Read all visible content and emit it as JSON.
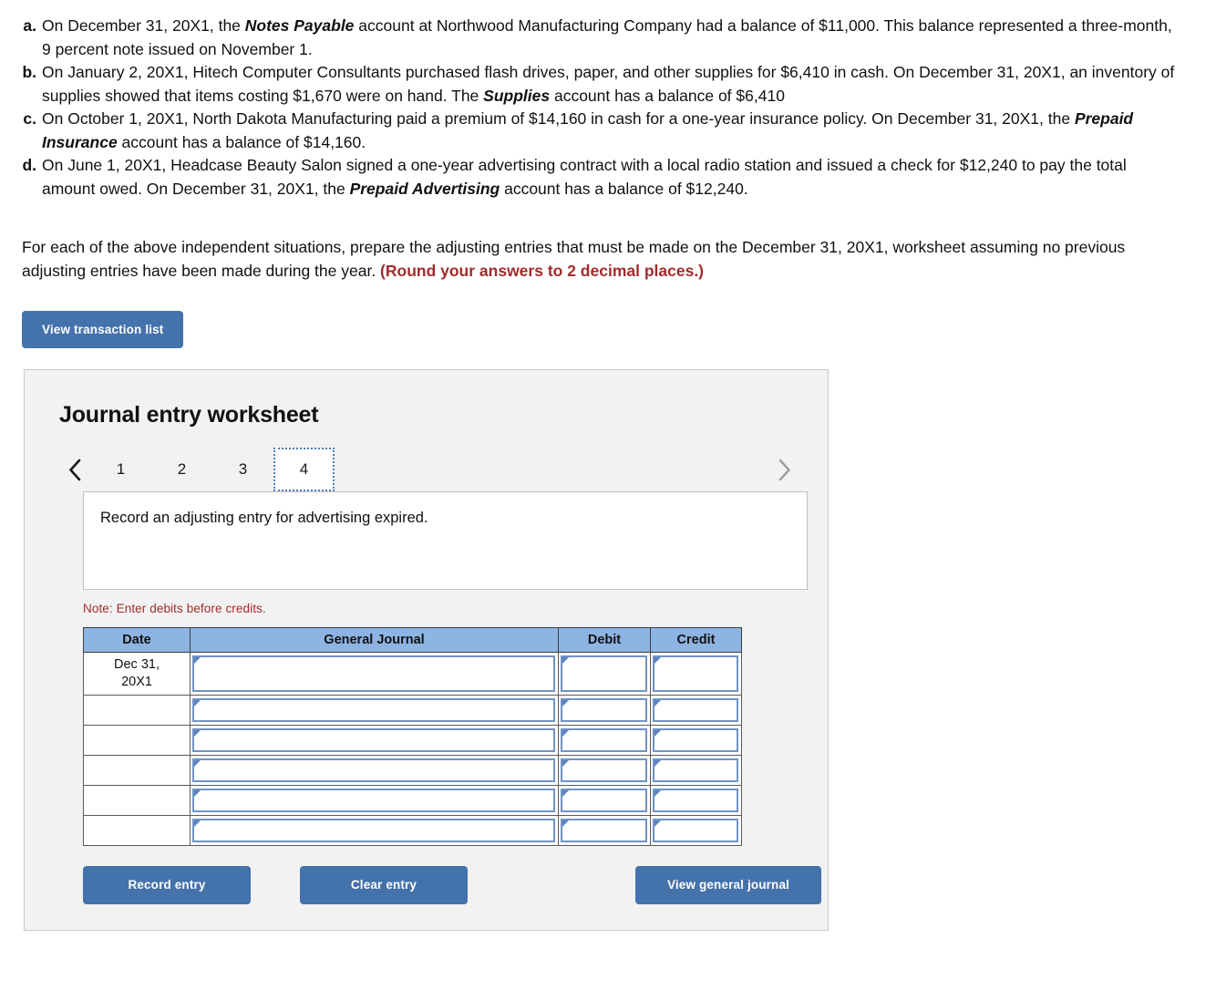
{
  "problems": [
    {
      "letter": "a.",
      "parts": [
        {
          "t": "On December 31, 20X1, the ",
          "b": false
        },
        {
          "t": "Notes Payable",
          "b": true
        },
        {
          "t": " account at Northwood Manufacturing Company had a balance of $11,000. This balance represented a three-month, 9 percent note issued on November 1.",
          "b": false
        }
      ]
    },
    {
      "letter": "b.",
      "parts": [
        {
          "t": "On January 2, 20X1, Hitech Computer Consultants purchased flash drives, paper, and other supplies for $6,410 in cash. On December 31, 20X1, an inventory of supplies showed that items costing $1,670 were on hand. The ",
          "b": false
        },
        {
          "t": "Supplies",
          "b": true
        },
        {
          "t": " account has a balance of $6,410",
          "b": false
        }
      ]
    },
    {
      "letter": "c.",
      "parts": [
        {
          "t": "On October 1, 20X1, North Dakota Manufacturing paid a premium of $14,160 in cash for a one-year insurance policy. On December 31, 20X1, the ",
          "b": false
        },
        {
          "t": "Prepaid Insurance",
          "b": true
        },
        {
          "t": " account has a balance of $14,160.",
          "b": false
        }
      ]
    },
    {
      "letter": "d.",
      "parts": [
        {
          "t": "On June 1, 20X1, Headcase Beauty Salon signed a one-year advertising contract with a local radio station and issued a check for $12,240 to pay the total amount owed. On December 31, 20X1, the ",
          "b": false
        },
        {
          "t": "Prepaid Advertising",
          "b": true
        },
        {
          "t": " account has a balance of $12,240.",
          "b": false
        }
      ]
    }
  ],
  "instruction": {
    "main": "For each of the above independent situations, prepare the adjusting entries that must be made on the December 31, 20X1, worksheet assuming no previous adjusting entries have been made during the year. ",
    "emphasis": "(Round your answers to 2 decimal places.)"
  },
  "transaction_button": {
    "label": "View transaction list"
  },
  "worksheet": {
    "title": "Journal entry worksheet",
    "prev_arrow_icon": "chevron-left-icon",
    "next_arrow_icon": "chevron-right-icon",
    "tabs": [
      {
        "label": "1",
        "active": false
      },
      {
        "label": "2",
        "active": false
      },
      {
        "label": "3",
        "active": false
      },
      {
        "label": "4",
        "active": true
      }
    ],
    "description": "Record an adjusting entry for advertising expired.",
    "note": "Note: Enter debits before credits.",
    "table": {
      "headers": [
        "Date",
        "General Journal",
        "Debit",
        "Credit"
      ],
      "rows": [
        {
          "date": "Dec 31,\n20X1",
          "general_journal": "",
          "debit": "",
          "credit": ""
        },
        {
          "date": "",
          "general_journal": "",
          "debit": "",
          "credit": ""
        },
        {
          "date": "",
          "general_journal": "",
          "debit": "",
          "credit": ""
        },
        {
          "date": "",
          "general_journal": "",
          "debit": "",
          "credit": ""
        },
        {
          "date": "",
          "general_journal": "",
          "debit": "",
          "credit": ""
        },
        {
          "date": "",
          "general_journal": "",
          "debit": "",
          "credit": ""
        }
      ]
    },
    "buttons": {
      "record": "Record entry",
      "clear": "Clear entry",
      "view_general_journal": "View general journal"
    }
  },
  "colors": {
    "button_blue": "#4472ab",
    "table_header_blue": "#8db4e2",
    "input_border_blue": "#6f93c6",
    "alert_red": "#a32b2b",
    "panel_gray": "#f2f2f2"
  }
}
